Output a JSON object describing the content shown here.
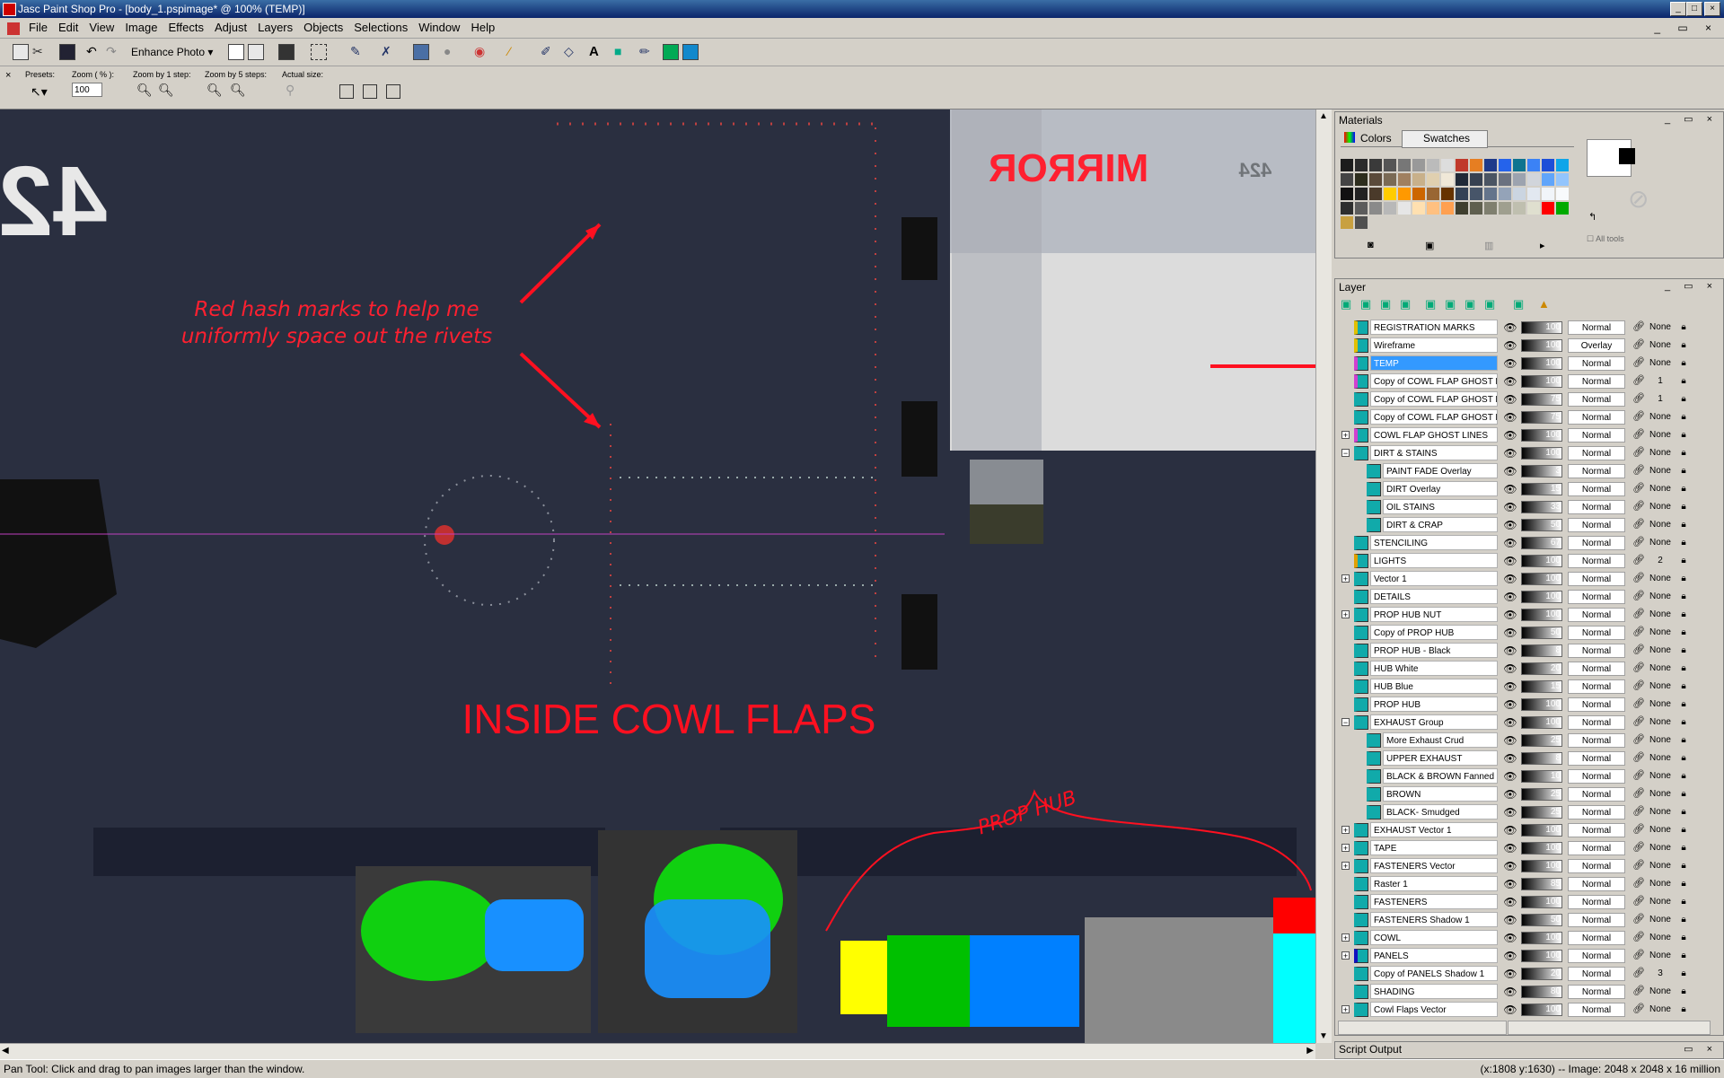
{
  "window": {
    "title": "Jasc Paint Shop Pro - [body_1.pspimage* @ 100% (TEMP)]",
    "buttons": [
      "_",
      "□",
      "×"
    ]
  },
  "menu": [
    "File",
    "Edit",
    "View",
    "Image",
    "Effects",
    "Adjust",
    "Layers",
    "Objects",
    "Selections",
    "Window",
    "Help"
  ],
  "toolbar": {
    "enhance_label": "Enhance Photo ▾"
  },
  "tool_options": {
    "presets_label": "Presets:",
    "zoom_label": "Zoom ( % ):",
    "zoom_value": "100",
    "zoom_by1_label": "Zoom by 1 step:",
    "zoom_by5_label": "Zoom by 5 steps:",
    "actual_label": "Actual size:"
  },
  "canvas": {
    "stencil_number": "42",
    "mirror_text": "MIRROR",
    "tail_number": "424",
    "annotation_rivets": "Red hash marks to help me\nuniformly space out the rivets",
    "label_cowl": "INSIDE COWL FLAPS",
    "label_prop": "PROP HUB",
    "colors": {
      "yellow": "#ffff00",
      "green": "#00c000",
      "blue": "#0080ff",
      "red": "#ff0000",
      "cyan": "#00ffff",
      "gray": "#8a8a8a"
    }
  },
  "status": {
    "left": "Pan Tool: Click and drag to pan images larger than the window.",
    "right": "(x:1808 y:1630) -- Image:  2048 x 2048 x 16 million"
  },
  "materials": {
    "title": "Materials",
    "tabs": [
      "Colors",
      "Swatches"
    ],
    "all_tools": "All tools",
    "swatches": [
      "#1c1c1c",
      "#2b2b2b",
      "#3a3a3a",
      "#555",
      "#777",
      "#999",
      "#bbb",
      "#ddd",
      "#c0392b",
      "#e67e22",
      "#1e3a8a",
      "#2563eb",
      "#0e7490",
      "#3b82f6",
      "#1d4ed8",
      "#0ea5e9",
      "#444",
      "#2d2d1d",
      "#5a4a3a",
      "#7a6a55",
      "#a08060",
      "#c8b08a",
      "#e0d0b0",
      "#f0e8d8",
      "#1f2937",
      "#374151",
      "#4b5563",
      "#6b7280",
      "#9ca3af",
      "#d1d5db",
      "#60a5fa",
      "#93c5fd",
      "#111",
      "#222",
      "#4a3a2a",
      "#ffcc00",
      "#ff9900",
      "#cc6600",
      "#996633",
      "#663300",
      "#334155",
      "#475569",
      "#64748b",
      "#94a3b8",
      "#cbd5e1",
      "#e2e8f0",
      "#f1f5f9",
      "#f8fafc",
      "#2e2e2e",
      "#5c5c5c",
      "#8a8a8a",
      "#b8b8b8",
      "#e6e6e6",
      "#ffe0b0",
      "#ffc080",
      "#ffa050",
      "#3f3f2f",
      "#5f5f4f",
      "#7f7f6f",
      "#9f9f8f",
      "#bfbfaf",
      "#dfdfcf",
      "#ff0000",
      "#00aa00",
      "#c8a040",
      "#505050"
    ]
  },
  "layers": {
    "title": "Layer",
    "items": [
      {
        "name": "REGISTRATION MARKS",
        "opacity": "100",
        "blend": "Normal",
        "group": "None",
        "indent": 0,
        "exp": "",
        "icon": "#e0c000"
      },
      {
        "name": "Wireframe",
        "opacity": "100",
        "blend": "Overlay",
        "group": "None",
        "indent": 0,
        "exp": "",
        "icon": "#e0c000"
      },
      {
        "name": "TEMP",
        "opacity": "100",
        "blend": "Normal",
        "group": "None",
        "indent": 0,
        "exp": "",
        "icon": "#d040d0",
        "sel": true
      },
      {
        "name": "Copy of COWL FLAP GHOST LINES",
        "opacity": "100",
        "blend": "Normal",
        "group": "1",
        "indent": 0,
        "exp": "",
        "icon": "#d040d0"
      },
      {
        "name": "Copy of COWL FLAP GHOST LINES",
        "opacity": "75",
        "blend": "Normal",
        "group": "1",
        "indent": 0,
        "exp": "",
        "icon": "#1aa"
      },
      {
        "name": "Copy of COWL FLAP GHOST LINES",
        "opacity": "75",
        "blend": "Normal",
        "group": "None",
        "indent": 0,
        "exp": "",
        "icon": "#1aa"
      },
      {
        "name": "COWL FLAP GHOST LINES",
        "opacity": "100",
        "blend": "Normal",
        "group": "None",
        "indent": 0,
        "exp": "+",
        "icon": "#d040d0"
      },
      {
        "name": "DIRT & STAINS",
        "opacity": "100",
        "blend": "Normal",
        "group": "None",
        "indent": 0,
        "exp": "−",
        "icon": "#1aa"
      },
      {
        "name": "PAINT FADE Overlay",
        "opacity": "3",
        "blend": "Normal",
        "group": "None",
        "indent": 1,
        "exp": "",
        "icon": "#1aa"
      },
      {
        "name": "DIRT Overlay",
        "opacity": "15",
        "blend": "Normal",
        "group": "None",
        "indent": 1,
        "exp": "",
        "icon": "#1aa"
      },
      {
        "name": "OIL STAINS",
        "opacity": "33",
        "blend": "Normal",
        "group": "None",
        "indent": 1,
        "exp": "",
        "icon": "#1aa"
      },
      {
        "name": "DIRT & CRAP",
        "opacity": "50",
        "blend": "Normal",
        "group": "None",
        "indent": 1,
        "exp": "",
        "icon": "#1aa"
      },
      {
        "name": "STENCILING",
        "opacity": "67",
        "blend": "Normal",
        "group": "None",
        "indent": 0,
        "exp": "",
        "icon": "#1aa"
      },
      {
        "name": "LIGHTS",
        "opacity": "100",
        "blend": "Normal",
        "group": "2",
        "indent": 0,
        "exp": "",
        "icon": "#e0a000"
      },
      {
        "name": "Vector 1",
        "opacity": "100",
        "blend": "Normal",
        "group": "None",
        "indent": 0,
        "exp": "+",
        "icon": "#1aa"
      },
      {
        "name": "DETAILS",
        "opacity": "100",
        "blend": "Normal",
        "group": "None",
        "indent": 0,
        "exp": "",
        "icon": "#1aa"
      },
      {
        "name": "PROP HUB NUT",
        "opacity": "100",
        "blend": "Normal",
        "group": "None",
        "indent": 0,
        "exp": "+",
        "icon": "#1aa"
      },
      {
        "name": "Copy of PROP HUB",
        "opacity": "50",
        "blend": "Normal",
        "group": "None",
        "indent": 0,
        "exp": "",
        "icon": "#1aa"
      },
      {
        "name": "PROP HUB - Black",
        "opacity": "8",
        "blend": "Normal",
        "group": "None",
        "indent": 0,
        "exp": "",
        "icon": "#1aa"
      },
      {
        "name": "HUB White",
        "opacity": "20",
        "blend": "Normal",
        "group": "None",
        "indent": 0,
        "exp": "",
        "icon": "#1aa"
      },
      {
        "name": "HUB Blue",
        "opacity": "15",
        "blend": "Normal",
        "group": "None",
        "indent": 0,
        "exp": "",
        "icon": "#1aa"
      },
      {
        "name": "PROP HUB",
        "opacity": "100",
        "blend": "Normal",
        "group": "None",
        "indent": 0,
        "exp": "",
        "icon": "#1aa"
      },
      {
        "name": "EXHAUST Group",
        "opacity": "100",
        "blend": "Normal",
        "group": "None",
        "indent": 0,
        "exp": "−",
        "icon": "#1aa"
      },
      {
        "name": "More Exhaust Crud",
        "opacity": "25",
        "blend": "Normal",
        "group": "None",
        "indent": 1,
        "exp": "",
        "icon": "#1aa"
      },
      {
        "name": "UPPER EXHAUST",
        "opacity": "8",
        "blend": "Normal",
        "group": "None",
        "indent": 1,
        "exp": "",
        "icon": "#1aa"
      },
      {
        "name": "BLACK & BROWN Fanned out",
        "opacity": "10",
        "blend": "Normal",
        "group": "None",
        "indent": 1,
        "exp": "",
        "icon": "#1aa"
      },
      {
        "name": "BROWN",
        "opacity": "25",
        "blend": "Normal",
        "group": "None",
        "indent": 1,
        "exp": "",
        "icon": "#1aa"
      },
      {
        "name": "BLACK- Smudged",
        "opacity": "25",
        "blend": "Normal",
        "group": "None",
        "indent": 1,
        "exp": "",
        "icon": "#1aa"
      },
      {
        "name": "EXHAUST Vector 1",
        "opacity": "100",
        "blend": "Normal",
        "group": "None",
        "indent": 0,
        "exp": "+",
        "icon": "#1aa"
      },
      {
        "name": "TAPE",
        "opacity": "100",
        "blend": "Normal",
        "group": "None",
        "indent": 0,
        "exp": "+",
        "icon": "#1aa"
      },
      {
        "name": "FASTENERS Vector",
        "opacity": "100",
        "blend": "Normal",
        "group": "None",
        "indent": 0,
        "exp": "+",
        "icon": "#1aa"
      },
      {
        "name": "Raster 1",
        "opacity": "85",
        "blend": "Normal",
        "group": "None",
        "indent": 0,
        "exp": "",
        "icon": "#1aa"
      },
      {
        "name": "FASTENERS",
        "opacity": "100",
        "blend": "Normal",
        "group": "None",
        "indent": 0,
        "exp": "",
        "icon": "#1aa"
      },
      {
        "name": "FASTENERS Shadow 1",
        "opacity": "50",
        "blend": "Normal",
        "group": "None",
        "indent": 0,
        "exp": "",
        "icon": "#1aa"
      },
      {
        "name": "COWL",
        "opacity": "100",
        "blend": "Normal",
        "group": "None",
        "indent": 0,
        "exp": "+",
        "icon": "#1aa"
      },
      {
        "name": "PANELS",
        "opacity": "100",
        "blend": "Normal",
        "group": "None",
        "indent": 0,
        "exp": "+",
        "icon": "#1010c0"
      },
      {
        "name": "Copy of PANELS Shadow 1",
        "opacity": "20",
        "blend": "Normal",
        "group": "3",
        "indent": 0,
        "exp": "",
        "icon": "#1aa"
      },
      {
        "name": "SHADING",
        "opacity": "80",
        "blend": "Normal",
        "group": "None",
        "indent": 0,
        "exp": "",
        "icon": "#1aa"
      },
      {
        "name": "Cowl Flaps Vector",
        "opacity": "100",
        "blend": "Normal",
        "group": "None",
        "indent": 0,
        "exp": "+",
        "icon": "#1aa"
      }
    ]
  },
  "script_output": {
    "title": "Script Output"
  }
}
